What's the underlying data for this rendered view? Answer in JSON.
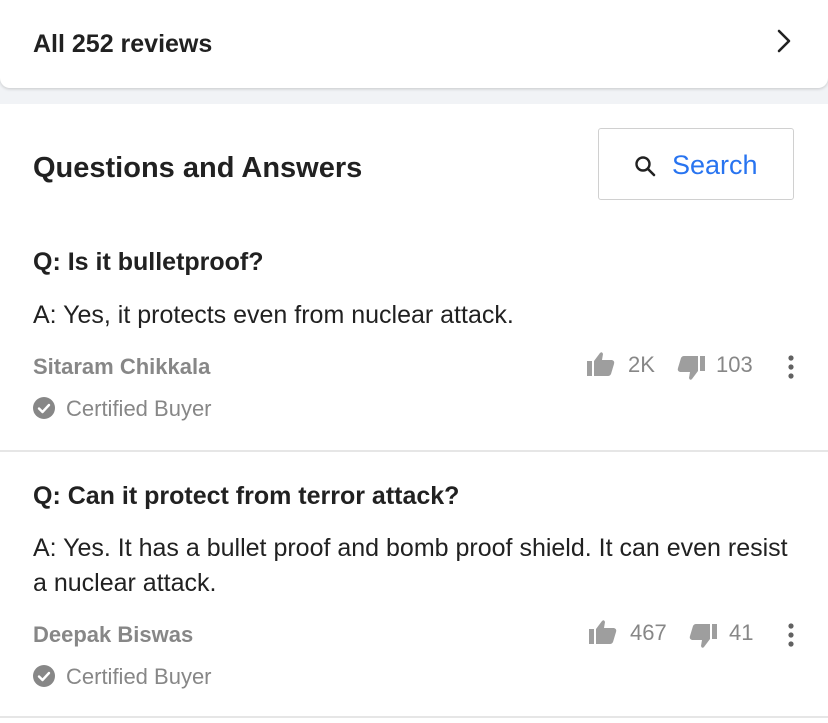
{
  "reviews": {
    "label": "All 252 reviews"
  },
  "qa": {
    "title": "Questions and Answers",
    "search_label": "Search",
    "items": [
      {
        "question": "Q: Is it bulletproof?",
        "answer": "A: Yes, it protects even from nuclear attack.",
        "author": "Sitaram Chikkala",
        "badge": "Certified Buyer",
        "likes": "2K",
        "dislikes": "103"
      },
      {
        "question": "Q: Can it protect from terror attack?",
        "answer": "A: Yes. It has a bullet proof and bomb proof shield. It can even resist a nuclear attack.",
        "author": "Deepak Biswas",
        "badge": "Certified Buyer",
        "likes": "467",
        "dislikes": "41"
      }
    ]
  },
  "colors": {
    "accent": "#2874f0",
    "text": "#212121",
    "muted": "#878787",
    "background": "#f1f3f6"
  },
  "icons": [
    "chevron-right-icon",
    "search-icon",
    "thumbs-up-icon",
    "thumbs-down-icon",
    "more-vertical-icon",
    "check-circle-icon"
  ]
}
